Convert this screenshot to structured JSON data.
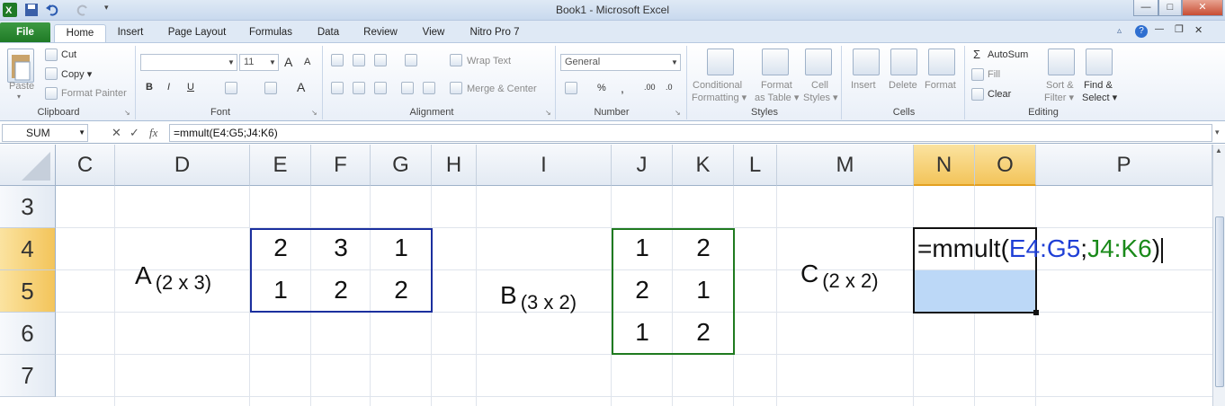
{
  "window": {
    "title": "Book1 - Microsoft Excel",
    "controls": {
      "minimize": "—",
      "maximize": "□",
      "close": "✕"
    },
    "ribbon_controls": {
      "help": "?",
      "min": "—",
      "restore": "❐",
      "close": "✕"
    }
  },
  "tabs": [
    "File",
    "Home",
    "Insert",
    "Page Layout",
    "Formulas",
    "Data",
    "Review",
    "View",
    "Nitro Pro 7"
  ],
  "ribbon": {
    "clipboard": {
      "label": "Clipboard",
      "paste": "Paste",
      "cut": "Cut",
      "copy": "Copy ▾",
      "format_painter": "Format Painter"
    },
    "font": {
      "label": "Font",
      "font_size": "11",
      "bold": "B",
      "italic": "I",
      "underline": "U",
      "grow": "A",
      "shrink": "A"
    },
    "alignment": {
      "label": "Alignment",
      "wrap_text": "Wrap Text",
      "merge_center": "Merge & Center"
    },
    "number": {
      "label": "Number",
      "format": "General",
      "percent": "%",
      "comma": ",",
      "inc_dec": ".00",
      "dec_dec": ".0"
    },
    "styles": {
      "label": "Styles",
      "conditional_1": "Conditional",
      "conditional_2": "Formatting ▾",
      "format_table_1": "Format",
      "format_table_2": "as Table ▾",
      "cell_styles_1": "Cell",
      "cell_styles_2": "Styles ▾"
    },
    "cells": {
      "label": "Cells",
      "insert": "Insert",
      "delete": "Delete",
      "format": "Format"
    },
    "editing": {
      "label": "Editing",
      "autosum": "AutoSum",
      "fill": "Fill",
      "clear": "Clear",
      "sort_1": "Sort &",
      "sort_2": "Filter ▾",
      "find_1": "Find &",
      "find_2": "Select ▾"
    }
  },
  "formula_bar": {
    "name_box": "SUM",
    "fx": "fx",
    "formula": "=mmult(E4:G5;J4:K6)"
  },
  "grid": {
    "columns": [
      "C",
      "D",
      "E",
      "F",
      "G",
      "H",
      "I",
      "J",
      "K",
      "L",
      "M",
      "N",
      "O",
      "P"
    ],
    "rows": [
      "3",
      "4",
      "5",
      "6",
      "7"
    ],
    "matrix_a": {
      "label": "A",
      "dims": "(2 x 3)",
      "values": [
        [
          "2",
          "3",
          "1"
        ],
        [
          "1",
          "2",
          "2"
        ]
      ]
    },
    "matrix_b": {
      "label": "B",
      "dims": "(3 x 2)",
      "values": [
        [
          "1",
          "2"
        ],
        [
          "2",
          "1"
        ],
        [
          "1",
          "2"
        ]
      ]
    },
    "matrix_c": {
      "label": "C",
      "dims": "(2 x 2)"
    },
    "edit_formula": {
      "eq": "=mmult(",
      "ref1": "E4:G5",
      "sep": ";",
      "ref2": "J4:K6",
      "close": ")"
    }
  },
  "colors": {
    "ref1": "#1f3fd6",
    "ref2": "#1a8a1a",
    "selection": "#bcd8f7",
    "header_selected": "#f3c45a"
  }
}
